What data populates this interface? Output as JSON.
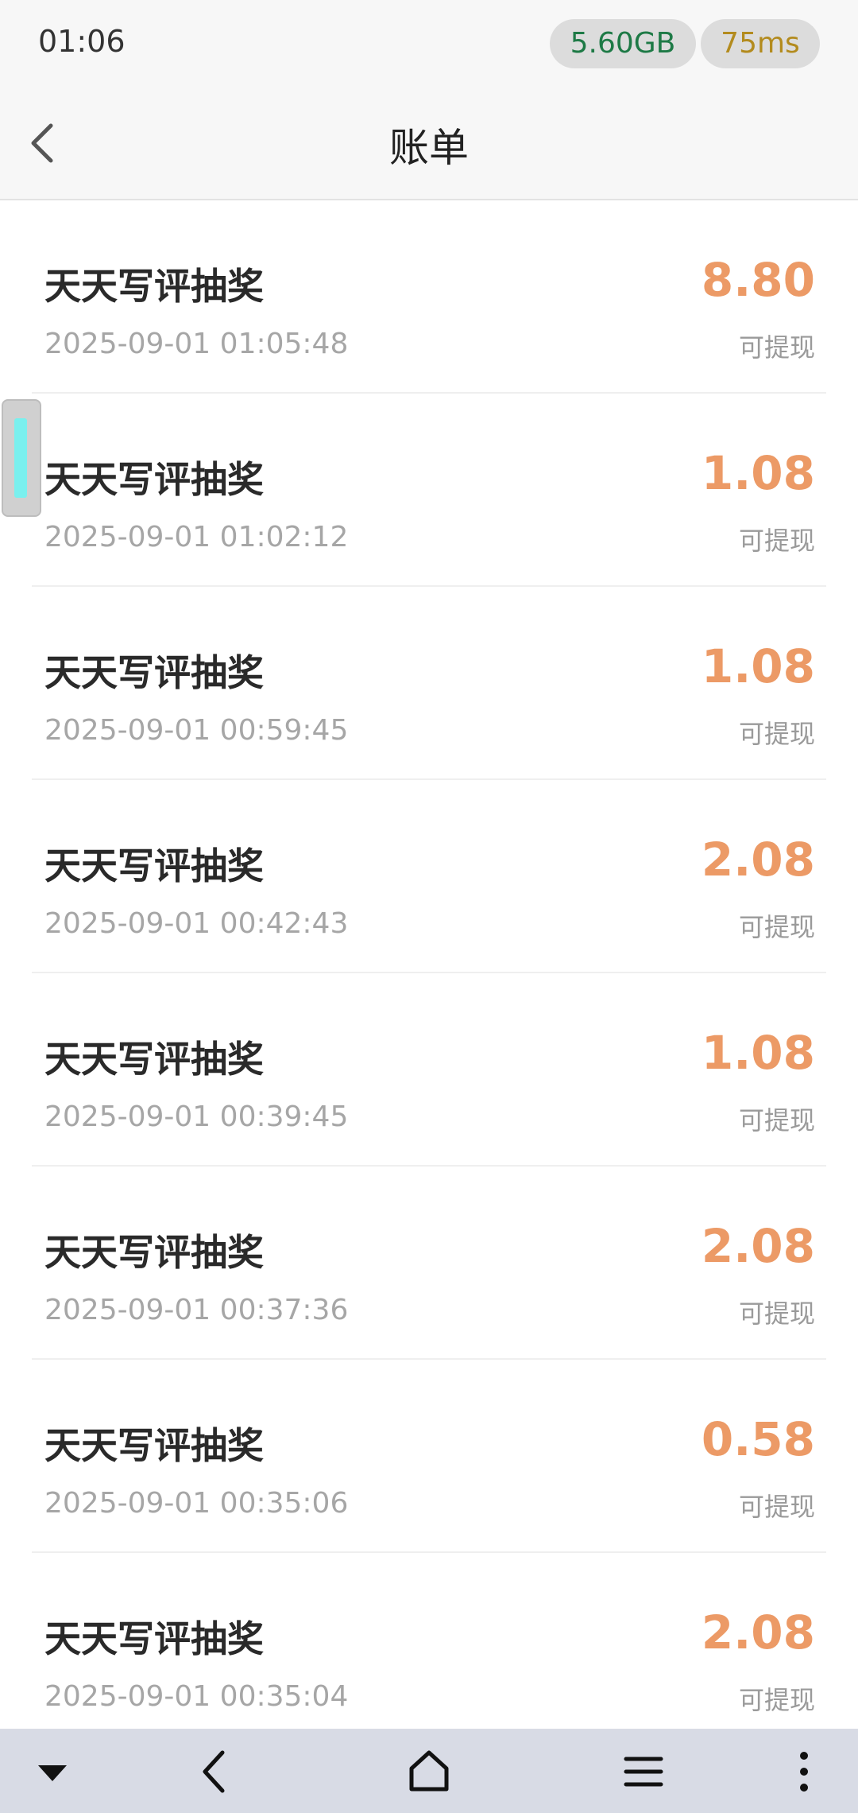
{
  "status_bar": {
    "time": "01:06",
    "memory": "5.60GB",
    "latency": "75ms",
    "memory_color": "#1e7a46",
    "latency_color": "#b38b1e"
  },
  "header": {
    "title": "账单",
    "back_icon": "chevron-left-icon"
  },
  "bills": [
    {
      "title": "天天写评抽奖",
      "time": "2025-09-01 01:05:48",
      "amount": "8.80",
      "status": "可提现"
    },
    {
      "title": "天天写评抽奖",
      "time": "2025-09-01 01:02:12",
      "amount": "1.08",
      "status": "可提现"
    },
    {
      "title": "天天写评抽奖",
      "time": "2025-09-01 00:59:45",
      "amount": "1.08",
      "status": "可提现"
    },
    {
      "title": "天天写评抽奖",
      "time": "2025-09-01 00:42:43",
      "amount": "2.08",
      "status": "可提现"
    },
    {
      "title": "天天写评抽奖",
      "time": "2025-09-01 00:39:45",
      "amount": "1.08",
      "status": "可提现"
    },
    {
      "title": "天天写评抽奖",
      "time": "2025-09-01 00:37:36",
      "amount": "2.08",
      "status": "可提现"
    },
    {
      "title": "天天写评抽奖",
      "time": "2025-09-01 00:35:06",
      "amount": "0.58",
      "status": "可提现"
    },
    {
      "title": "天天写评抽奖",
      "time": "2025-09-01 00:35:04",
      "amount": "2.08",
      "status": "可提现"
    }
  ],
  "colors": {
    "amount": "#ec9a66",
    "accent_handle": "#7af0ee"
  },
  "system_nav": {
    "icons": [
      "triangle-down-icon",
      "back-icon",
      "home-icon",
      "menu-icon",
      "more-vertical-icon"
    ]
  }
}
